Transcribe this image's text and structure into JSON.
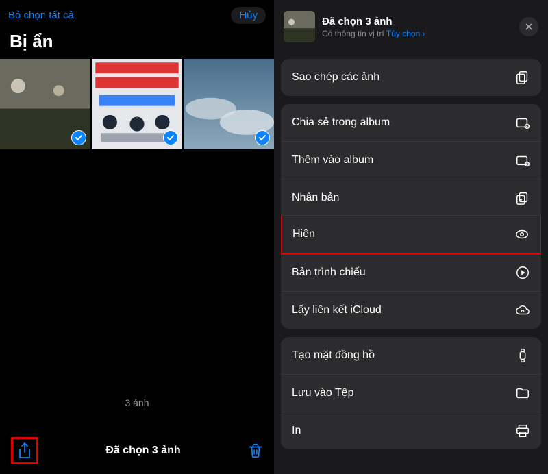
{
  "left": {
    "deselect_all": "Bỏ chọn tất cả",
    "cancel": "Hủy",
    "title": "Bị ẩn",
    "count_text": "3 ảnh",
    "toolbar_title": "Đã chọn 3 ảnh"
  },
  "sheet": {
    "title": "Đã chọn 3 ảnh",
    "subtitle_prefix": "Có thông tin vị trí ",
    "subtitle_options": "Tùy chọn",
    "groups": [
      {
        "items": [
          {
            "label": "Sao chép các ảnh",
            "icon": "copy"
          }
        ]
      },
      {
        "items": [
          {
            "label": "Chia sẻ trong album",
            "icon": "album-share"
          },
          {
            "label": "Thêm vào album",
            "icon": "album-add"
          },
          {
            "label": "Nhân bản",
            "icon": "duplicate"
          },
          {
            "label": "Hiện",
            "icon": "eye",
            "highlight": true
          },
          {
            "label": "Bản trình chiếu",
            "icon": "play-circle"
          },
          {
            "label": "Lấy liên kết iCloud",
            "icon": "cloud-link"
          }
        ]
      },
      {
        "items": [
          {
            "label": "Tạo mặt đồng hồ",
            "icon": "watch"
          },
          {
            "label": "Lưu vào Tệp",
            "icon": "folder"
          },
          {
            "label": "In",
            "icon": "printer"
          }
        ]
      }
    ]
  }
}
